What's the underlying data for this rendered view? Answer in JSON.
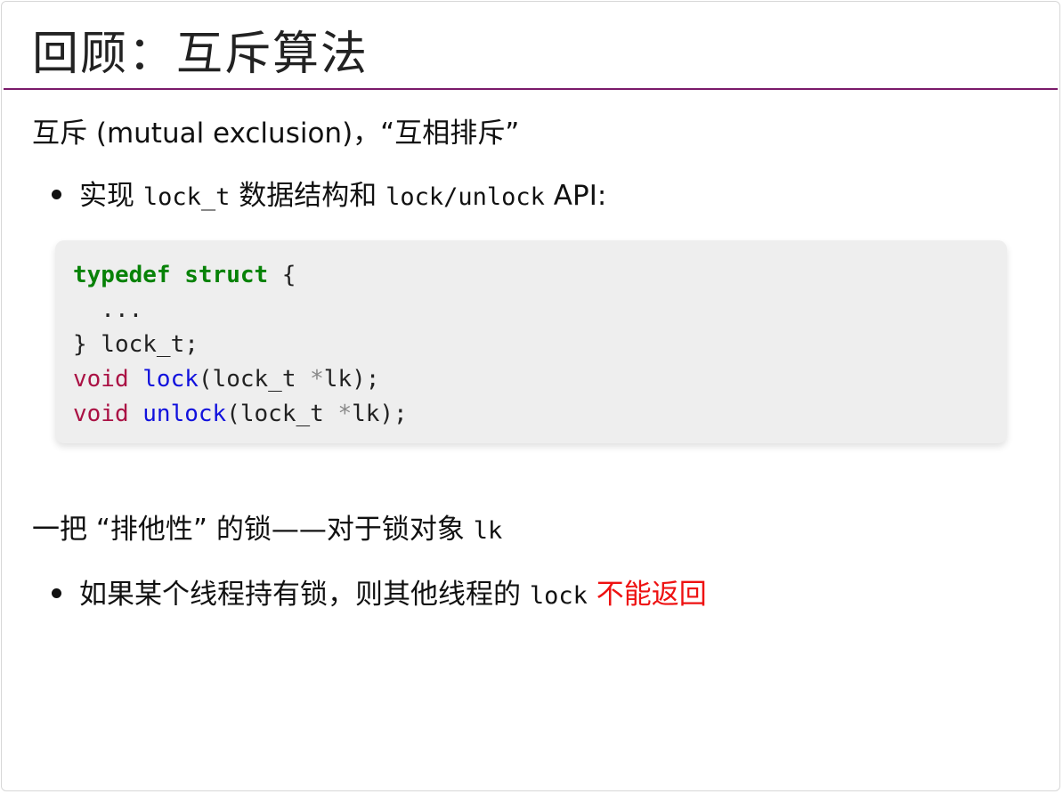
{
  "title": "回顾：互斥算法",
  "intro": {
    "text": "互斥 (mutual exclusion)，“互相排斥”"
  },
  "bullet1": {
    "t1": "实现 ",
    "code1": "lock_t",
    "t2": " 数据结构和 ",
    "code2": "lock/unlock",
    "t3": " API:"
  },
  "code": {
    "line1_kw1": "typedef",
    "line1_kw2": "struct",
    "line1_rest": " {",
    "line2": "  ...",
    "line3": "} lock_t;",
    "line4_type": "void",
    "line4_fn": "lock",
    "line4_args_a": "(lock_t ",
    "line4_star": "*",
    "line4_args_b": "lk);",
    "line5_type": "void",
    "line5_fn": "unlock",
    "line5_args_a": "(lock_t ",
    "line5_star": "*",
    "line5_args_b": "lk);"
  },
  "para2": {
    "text": "一把 “排他性” 的锁——对于锁对象 ",
    "code": "lk"
  },
  "bullet2": {
    "text": "如果某个线程持有锁，则其他线程的 ",
    "code": "lock",
    "emphasis": " 不能返回"
  },
  "colors": {
    "title_rule": "#7a1a6a",
    "keyword": "#088208",
    "type": "#aa1144",
    "function": "#1111dd",
    "emphasis": "#ee1111",
    "code_background": "#eeeeee"
  }
}
